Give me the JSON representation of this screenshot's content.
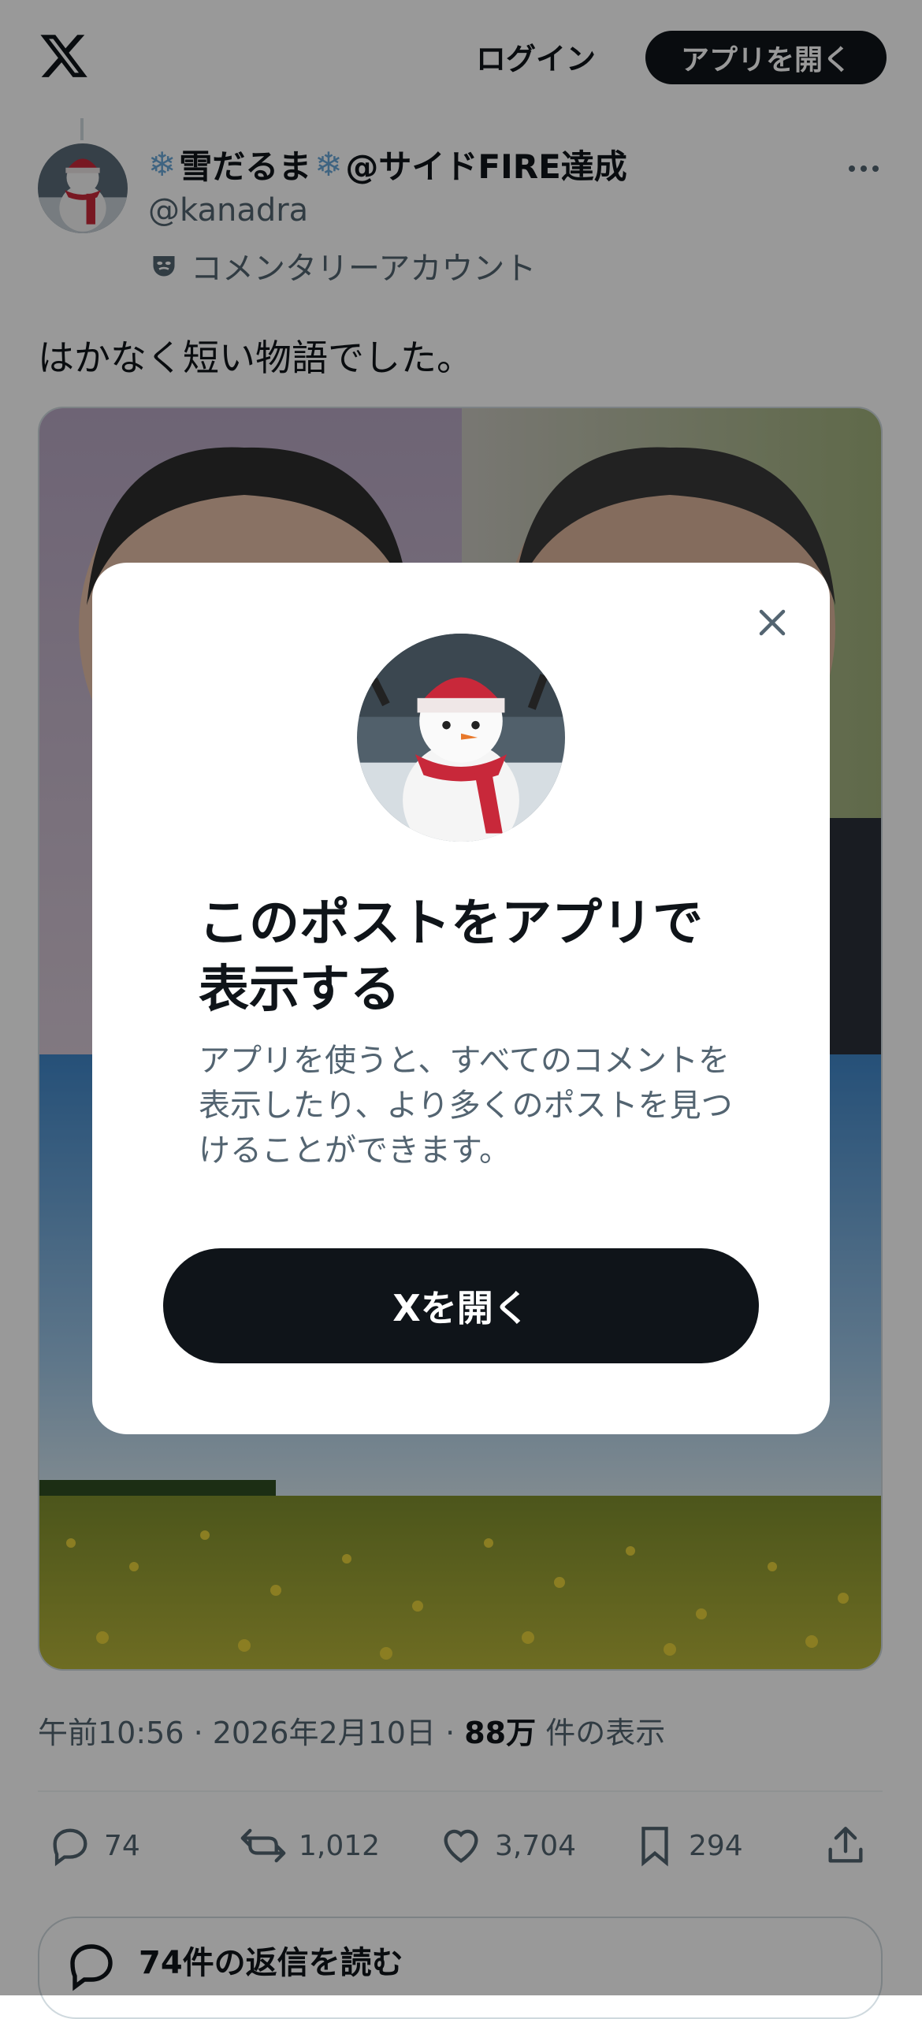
{
  "header": {
    "logo_icon": "x-logo-icon",
    "login_label": "ログイン",
    "open_app_label": "アプリを開く"
  },
  "post": {
    "display_name": "雪だるま",
    "display_name_suffix": "@サイドFIRE達成",
    "handle": "@kanadra",
    "account_label": "コメンタリーアカウント",
    "text": "はかなく短い物語でした。",
    "timestamp": "午前10:56 · 2026年2月10日 · ",
    "views_count": "88万",
    "views_label": " 件の表示"
  },
  "actions": {
    "replies": "74",
    "reposts": "1,012",
    "likes": "3,704",
    "bookmarks": "294"
  },
  "read_replies_label": "74件の返信を読む",
  "modal": {
    "title": "このポストをアプリで表示する",
    "description": "アプリを使うと、すべてのコメントを表示したり、より多くのポストを見つけることができます。",
    "cta_label": "Xを開く"
  },
  "colors": {
    "primary_dark": "#0f1419",
    "secondary_text": "#536471",
    "overlay": "rgba(0,0,0,0.40)"
  }
}
